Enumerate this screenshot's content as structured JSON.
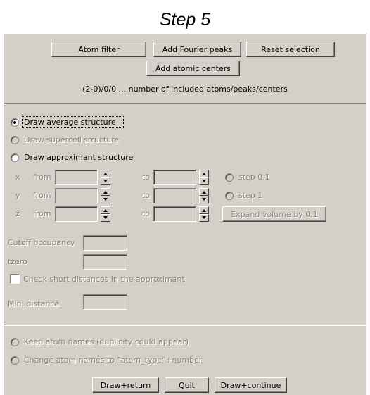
{
  "title": "Step 5",
  "top_buttons": {
    "atom_filter": "Atom filter",
    "add_fourier_peaks": "Add Fourier peaks",
    "reset_selection": "Reset selection",
    "add_atomic_centers": "Add atomic centers"
  },
  "counts_label": "(2-0)/0/0 ... number of included atoms/peaks/centers",
  "draw_mode": {
    "average": "Draw average structure",
    "supercell": "Draw supercell structure",
    "approximant": "Draw approximant structure",
    "selected": "average"
  },
  "ranges": {
    "from_label": "from",
    "to_label": "to",
    "rows": [
      {
        "axis": "x",
        "from": "",
        "to": ""
      },
      {
        "axis": "y",
        "from": "",
        "to": ""
      },
      {
        "axis": "z",
        "from": "",
        "to": ""
      }
    ]
  },
  "step_options": {
    "step_0_1": "step 0.1",
    "step_1": "step 1"
  },
  "expand_volume": "Expand volume by 0.1",
  "cutoff_occupancy": {
    "label": "Cutoff occupancy",
    "value": ""
  },
  "tzero": {
    "label": "tzero",
    "value": ""
  },
  "check_short": {
    "label": "Check short distances in the approximant",
    "checked": false
  },
  "min_distance": {
    "label": "Min. distance",
    "value": ""
  },
  "atom_names": {
    "keep": "Keep atom names (duplicity could appear)",
    "change": "Change atom names to \"atom_type\"+number"
  },
  "bottom_buttons": {
    "draw_return": "Draw+return",
    "quit": "Quit",
    "draw_continue": "Draw+continue"
  }
}
